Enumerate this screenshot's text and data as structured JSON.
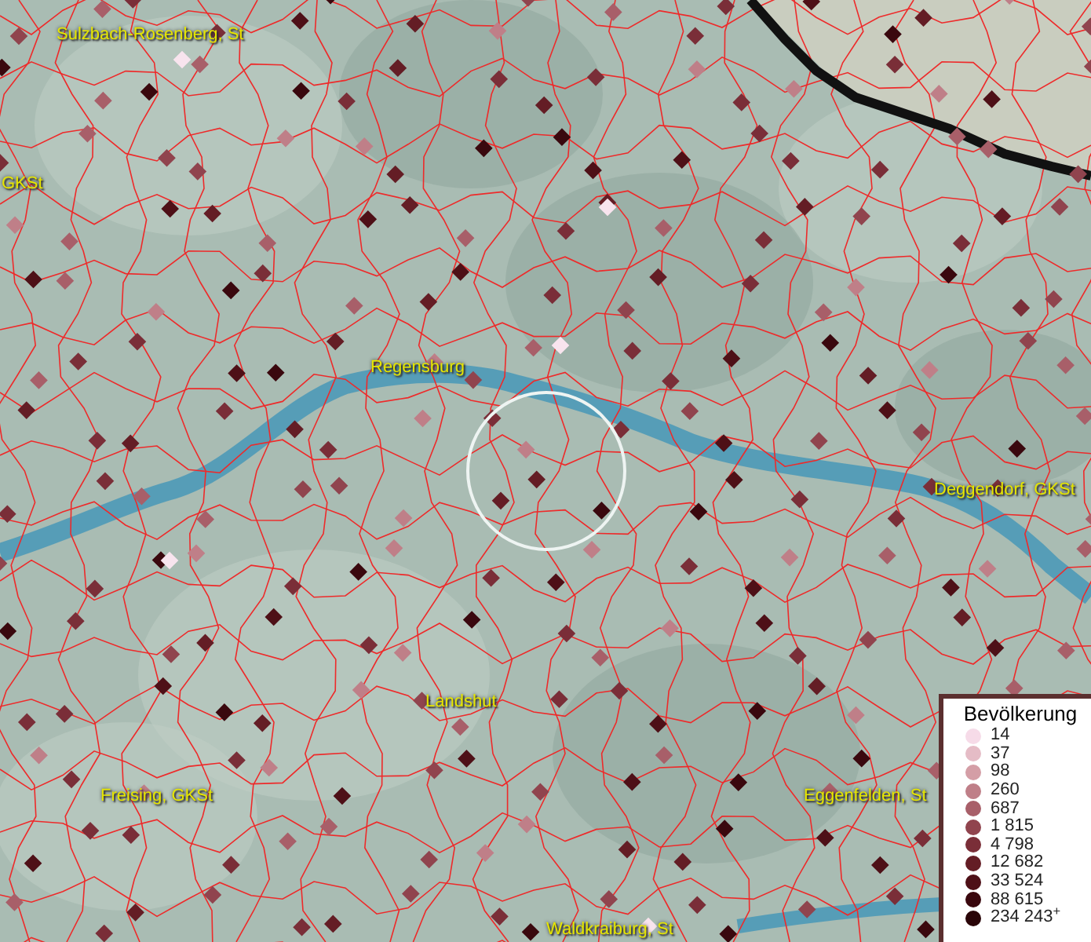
{
  "map": {
    "labels": [
      {
        "text": "Sulzbach-Rosenberg, St"
      },
      {
        "text": "GKSt"
      },
      {
        "text": "Regensburg"
      },
      {
        "text": "Deggendorf, GKSt"
      },
      {
        "text": "Landshut"
      },
      {
        "text": "Freising, GKSt"
      },
      {
        "text": "Eggenfelden, St"
      },
      {
        "text": "Waldkraiburg, St"
      }
    ]
  },
  "legend": {
    "title": "Bevölkerung",
    "items": [
      {
        "label": "14",
        "color": "#f6dbe8"
      },
      {
        "label": "37",
        "color": "#e5bcc6"
      },
      {
        "label": "98",
        "color": "#d49ea6"
      },
      {
        "label": "260",
        "color": "#bf7f88"
      },
      {
        "label": "687",
        "color": "#a85f69"
      },
      {
        "label": "1 815",
        "color": "#90444e"
      },
      {
        "label": "4 798",
        "color": "#7a2e38"
      },
      {
        "label": "12 682",
        "color": "#641d25"
      },
      {
        "label": "33 524",
        "color": "#4e1017"
      },
      {
        "label": "88 615",
        "color": "#3a080e"
      },
      {
        "label": "234 243$^{+}$",
        "color": "#2a0508"
      }
    ]
  }
}
